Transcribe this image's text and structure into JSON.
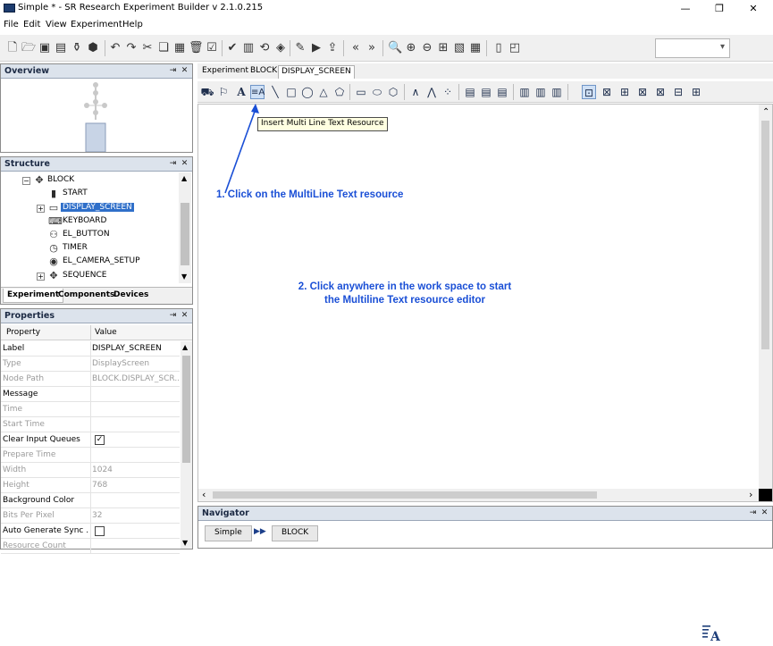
{
  "window": {
    "title": "Simple * - SR Research Experiment Builder v 2.1.0.215",
    "minimize": "—",
    "restore": "❐",
    "close": "✕"
  },
  "menu": [
    "File",
    "Edit",
    "View",
    "Experiment",
    "Help"
  ],
  "main_toolbar": {
    "icons": [
      "new-icon",
      "open-icon",
      "save-icon",
      "save-as-icon",
      "package-icon",
      "box-icon",
      "undo-icon",
      "redo-icon",
      "cut-icon",
      "copy-icon",
      "paste-icon",
      "delete-icon",
      "check-icon",
      "build-icon",
      "library-icon",
      "rotate-icon",
      "test-run-icon",
      "deploy-icon",
      "run-icon",
      "export-icon",
      "back-icon",
      "forward-icon",
      "zoom-icon",
      "zoom-in-icon",
      "zoom-out-icon",
      "grid-icon",
      "chart-icon",
      "table-icon",
      "door-icon",
      "window-icon"
    ],
    "zoom_value": ""
  },
  "overview": {
    "title": "Overview"
  },
  "structure": {
    "title": "Structure",
    "items": [
      {
        "label": "BLOCK",
        "icon": "block-icon"
      },
      {
        "label": "START",
        "icon": "start-icon"
      },
      {
        "label": "DISPLAY_SCREEN",
        "icon": "display-screen-icon",
        "selected": true
      },
      {
        "label": "KEYBOARD",
        "icon": "keyboard-icon"
      },
      {
        "label": "EL_BUTTON",
        "icon": "button-icon"
      },
      {
        "label": "TIMER",
        "icon": "timer-icon"
      },
      {
        "label": "EL_CAMERA_SETUP",
        "icon": "camera-icon"
      },
      {
        "label": "SEQUENCE",
        "icon": "sequence-icon"
      }
    ],
    "tabs": [
      "Experiment",
      "Components",
      "Devices"
    ]
  },
  "properties": {
    "title": "Properties",
    "col_property": "Property",
    "col_value": "Value",
    "rows": [
      {
        "name": "Label",
        "value": "DISPLAY_SCREEN",
        "dim": false
      },
      {
        "name": "Type",
        "value": "DisplayScreen",
        "dim": true
      },
      {
        "name": "Node Path",
        "value": "BLOCK.DISPLAY_SCR...",
        "dim": true
      },
      {
        "name": "Message",
        "value": "",
        "dim": false
      },
      {
        "name": "Time",
        "value": "",
        "dim": true
      },
      {
        "name": "Start Time",
        "value": "",
        "dim": true
      },
      {
        "name": "Clear Input Queues",
        "value": "",
        "dim": false,
        "checkbox": true,
        "checked": true
      },
      {
        "name": "Prepare Time",
        "value": "",
        "dim": true
      },
      {
        "name": "Width",
        "value": "1024",
        "dim": true
      },
      {
        "name": "Height",
        "value": "768",
        "dim": true
      },
      {
        "name": "Background Color",
        "value": "",
        "dim": false
      },
      {
        "name": "Bits Per Pixel",
        "value": "32",
        "dim": true
      },
      {
        "name": "Auto Generate Sync ...",
        "value": "",
        "dim": false,
        "checkbox": true,
        "checked": false
      },
      {
        "name": "Resource Count",
        "value": "",
        "dim": true
      }
    ]
  },
  "editor": {
    "tabs": [
      "Experiment",
      "BLOCK",
      "DISPLAY_SCREEN"
    ],
    "tooltip": "Insert Multi Line Text Resource",
    "note1": "1. Click on the MultiLine Text resource",
    "note2_line1": "2. Click anywhere in the work space to start",
    "note2_line2": "the Multiline Text resource editor",
    "text_icon_glyph": "A"
  },
  "navigator": {
    "title": "Navigator",
    "crumbs": [
      "Simple",
      "BLOCK"
    ],
    "separator": "▶▶"
  },
  "colors": {
    "annotation_blue": "#1a4fd6",
    "selection_blue": "#2f6fc9",
    "panel_header": "#dce3ec",
    "tooltip_bg": "#ffffe1"
  }
}
